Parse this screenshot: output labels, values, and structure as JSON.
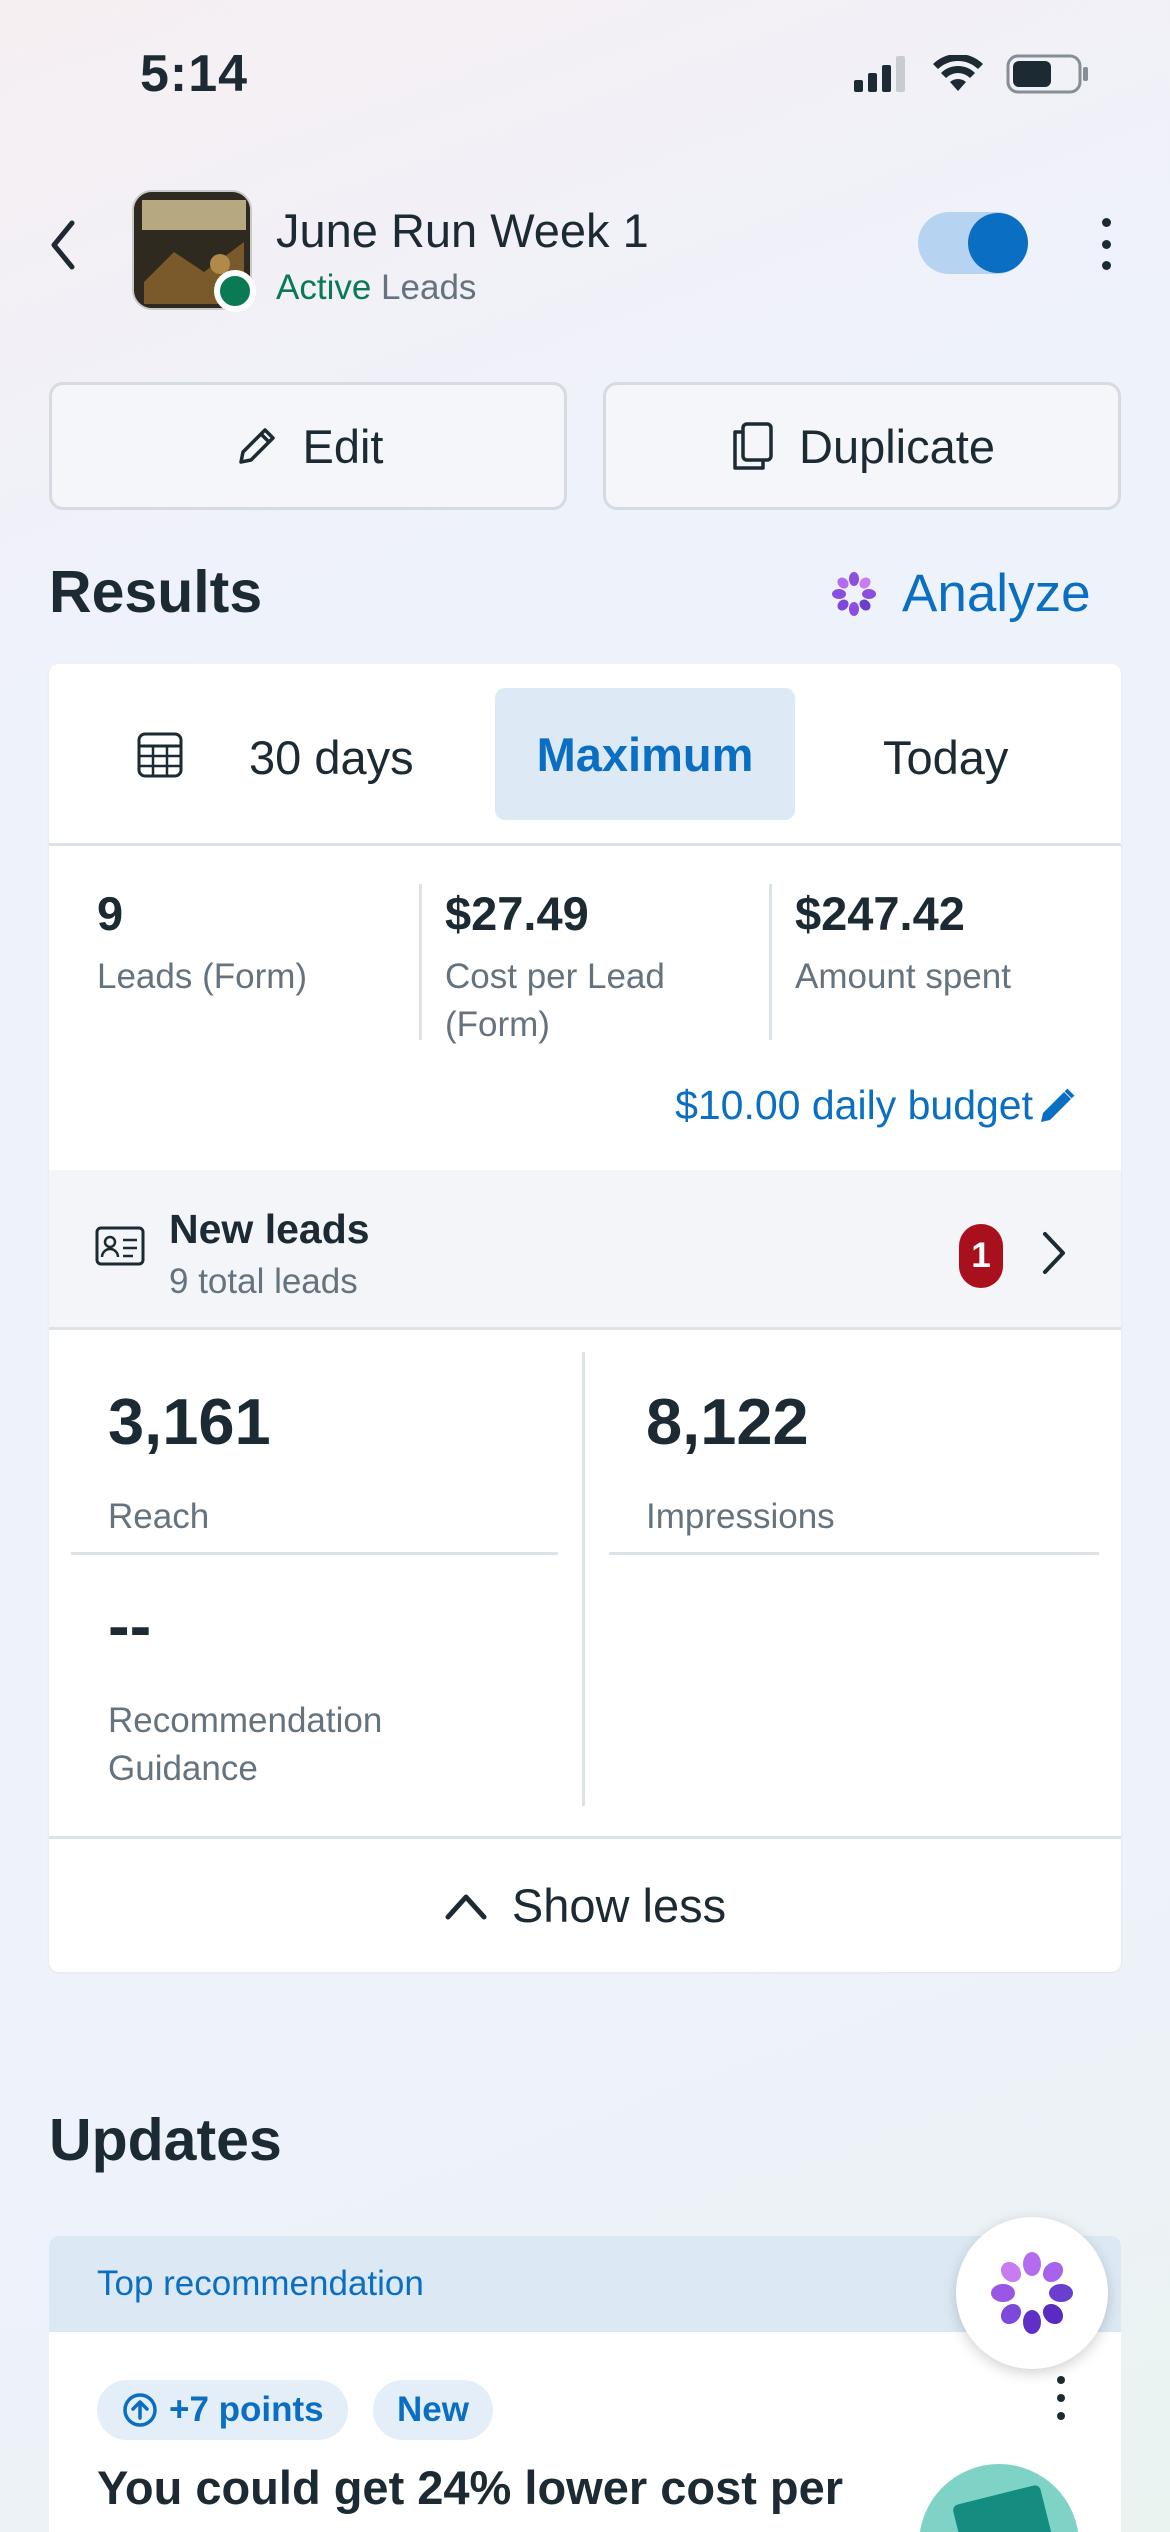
{
  "status_bar": {
    "time": "5:14"
  },
  "header": {
    "title": "June Run Week 1",
    "status": "Active",
    "type": "Leads",
    "toggle_on": true
  },
  "actions": {
    "edit_label": "Edit",
    "duplicate_label": "Duplicate"
  },
  "results": {
    "title": "Results",
    "analyze_label": "Analyze",
    "tabs": {
      "last_30": "30 days",
      "maximum": "Maximum",
      "today": "Today",
      "selected": "Maximum"
    },
    "metrics": [
      {
        "value": "9",
        "label": "Leads (Form)"
      },
      {
        "value": "$27.49",
        "label": "Cost per Lead (Form)"
      },
      {
        "value": "$247.42",
        "label": "Amount spent"
      }
    ],
    "budget_label": "$10.00 daily budget",
    "new_leads": {
      "title": "New leads",
      "subtitle": "9 total leads",
      "badge": "1"
    },
    "stats": {
      "reach": {
        "value": "3,161",
        "label": "Reach"
      },
      "impressions": {
        "value": "8,122",
        "label": "Impressions"
      },
      "recommendation": {
        "value": "--",
        "label": "Recommendation Guidance"
      }
    },
    "show_less_label": "Show less"
  },
  "updates": {
    "title": "Updates",
    "card": {
      "header": "Top recommendation",
      "points_pill": "+7 points",
      "new_pill": "New",
      "text": "You could get 24% lower cost per"
    }
  },
  "colors": {
    "accent": "#0a6fc2",
    "active_green": "#0a7a55",
    "badge_red": "#a8101e"
  }
}
